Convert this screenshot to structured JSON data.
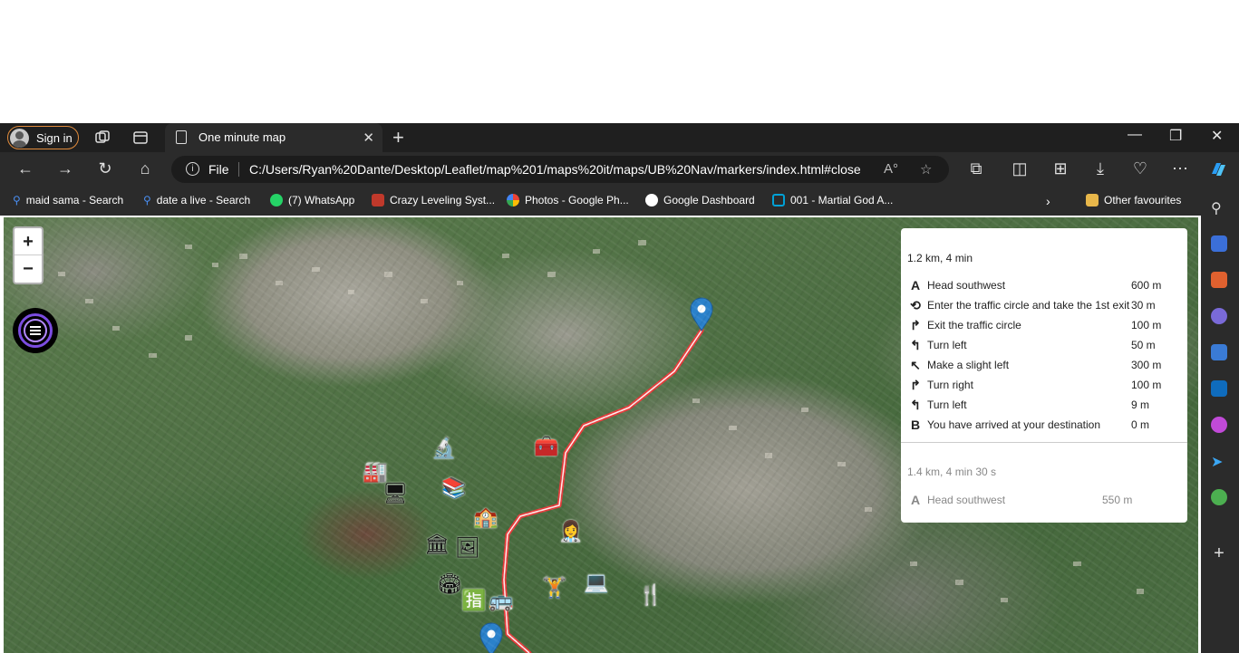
{
  "browser": {
    "signin_label": "Sign in",
    "tab_title": "One minute map",
    "address_prefix": "File",
    "url": "C:/Users/Ryan%20Dante/Desktop/Leaflet/map%201/maps%20it/maps/UB%20Nav/markers/index.html#close"
  },
  "favourites": [
    {
      "label": "maid sama - Search",
      "icon": "search-icon",
      "color": "#4a8ef0"
    },
    {
      "label": "date a live - Search",
      "icon": "search-icon",
      "color": "#4a8ef0"
    },
    {
      "label": "(7) WhatsApp",
      "icon": "whatsapp-icon",
      "color": "#25d366"
    },
    {
      "label": "Crazy Leveling Syst...",
      "icon": "site-icon",
      "color": "#c0392b"
    },
    {
      "label": "Photos - Google Ph...",
      "icon": "photos-icon",
      "color": "#f4b400"
    },
    {
      "label": "Google Dashboard",
      "icon": "google-icon",
      "color": "#ffffff"
    },
    {
      "label": "001 - Martial God A...",
      "icon": "tv-icon",
      "color": "#00a1d6"
    }
  ],
  "other_favourites": "Other favourites",
  "map": {
    "zoom_in": "+",
    "zoom_out": "−"
  },
  "routing": {
    "primary_summary": "1.2 km, 4 min",
    "instructions": [
      {
        "icon": "A",
        "text": "Head southwest",
        "distance": "600 m"
      },
      {
        "icon": "⟲",
        "text": "Enter the traffic circle and take the 1st exit",
        "distance": "30 m"
      },
      {
        "icon": "↱",
        "text": "Exit the traffic circle",
        "distance": "100 m"
      },
      {
        "icon": "↰",
        "text": "Turn left",
        "distance": "50 m"
      },
      {
        "icon": "↖",
        "text": "Make a slight left",
        "distance": "300 m"
      },
      {
        "icon": "↱",
        "text": "Turn right",
        "distance": "100 m"
      },
      {
        "icon": "↰",
        "text": "Turn left",
        "distance": "9 m"
      },
      {
        "icon": "B",
        "text": "You have arrived at your destination",
        "distance": "0 m"
      }
    ],
    "alt_summary": "1.4 km, 4 min 30 s",
    "alt_instructions": [
      {
        "icon": "A",
        "text": "Head southwest",
        "distance": "550 m"
      }
    ]
  },
  "colors": {
    "route_line": "#e63a3a",
    "marker": "#2a81cb",
    "signin_border": "#e08b3c"
  }
}
